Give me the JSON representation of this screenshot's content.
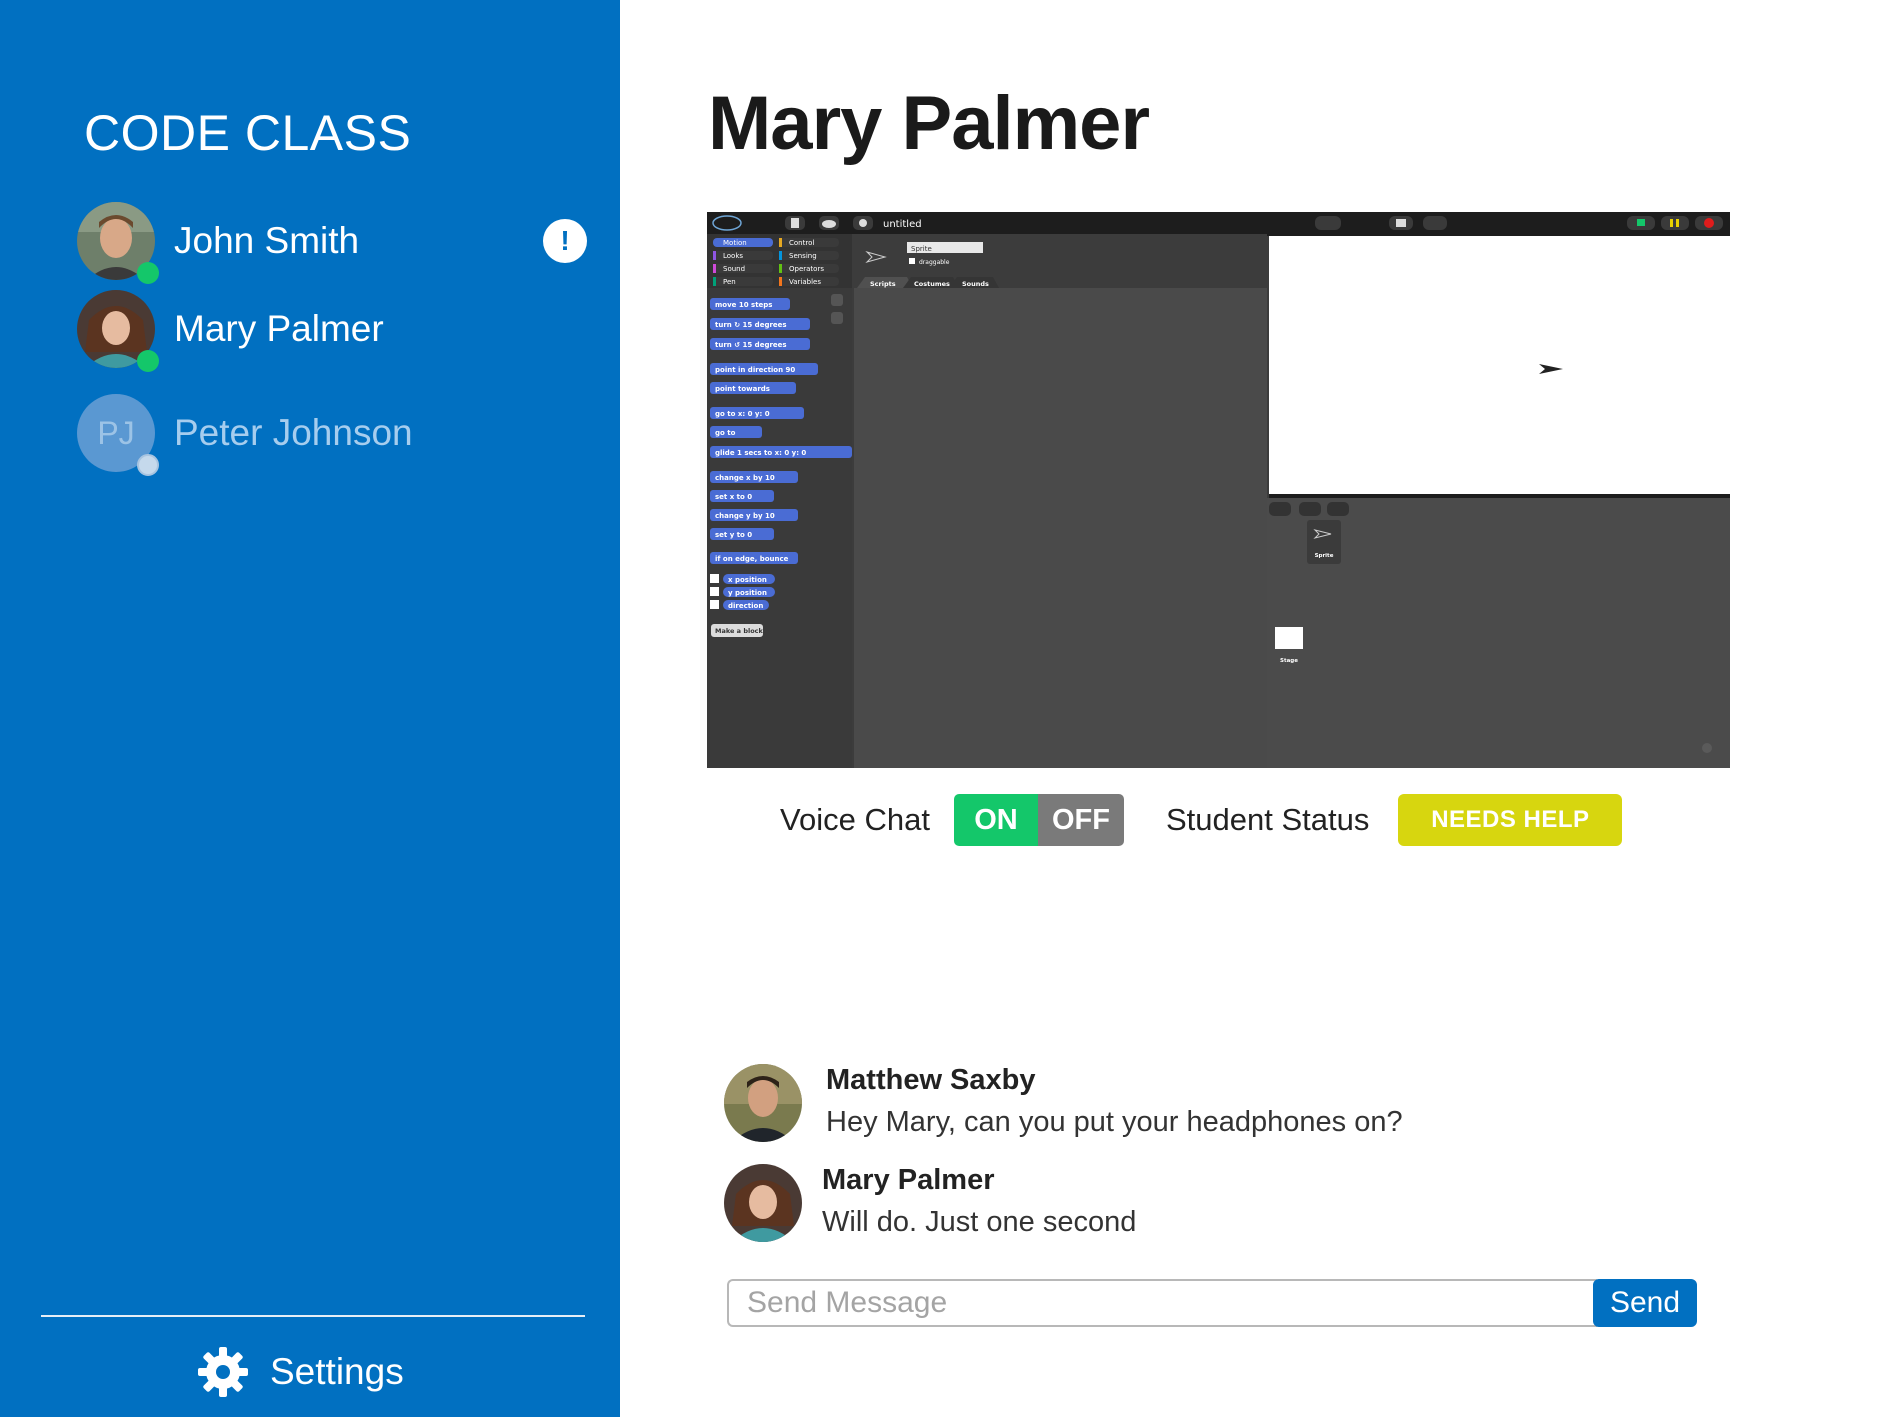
{
  "app": {
    "title": "CODE CLASS"
  },
  "students": [
    {
      "name": "John Smith",
      "status": "online",
      "alert": "!"
    },
    {
      "name": "Mary Palmer",
      "status": "online"
    },
    {
      "name": "Peter Johnson",
      "status": "offline",
      "initials": "PJ"
    }
  ],
  "settings": {
    "label": "Settings"
  },
  "main": {
    "title": "Mary Palmer"
  },
  "snap": {
    "project_name": "untitled",
    "categories": [
      "Motion",
      "Control",
      "Looks",
      "Sensing",
      "Sound",
      "Operators",
      "Pen",
      "Variables"
    ],
    "sprite_name": "Sprite",
    "draggable_label": "draggable",
    "tabs": [
      "Scripts",
      "Costumes",
      "Sounds"
    ],
    "blocks": [
      "move 10 steps",
      "turn ↻ 15 degrees",
      "turn ↺ 15 degrees",
      "point in direction 90",
      "point towards",
      "go to x: 0 y: 0",
      "go to",
      "glide 1 secs to x: 0 y: 0",
      "change x by 10",
      "set x to 0",
      "change y by 10",
      "set y to 0",
      "if on edge, bounce",
      "x position",
      "y position",
      "direction"
    ],
    "make_block": "Make a block",
    "corral_sprite": "Sprite",
    "corral_stage": "Stage"
  },
  "controls": {
    "voice_chat_label": "Voice Chat",
    "voice_on": "ON",
    "voice_off": "OFF",
    "student_status_label": "Student Status",
    "student_status_value": "NEEDS HELP"
  },
  "chat": {
    "messages": [
      {
        "sender": "Matthew Saxby",
        "text": "Hey Mary, can you put your headphones on?"
      },
      {
        "sender": "Mary Palmer",
        "text": "Will do. Just one second"
      }
    ],
    "placeholder": "Send Message",
    "send_label": "Send"
  },
  "colors": {
    "sidebar": "#0170c1",
    "online": "#14c76a",
    "needs_help": "#d7d60f",
    "toggle_off": "#7a7a7a"
  }
}
